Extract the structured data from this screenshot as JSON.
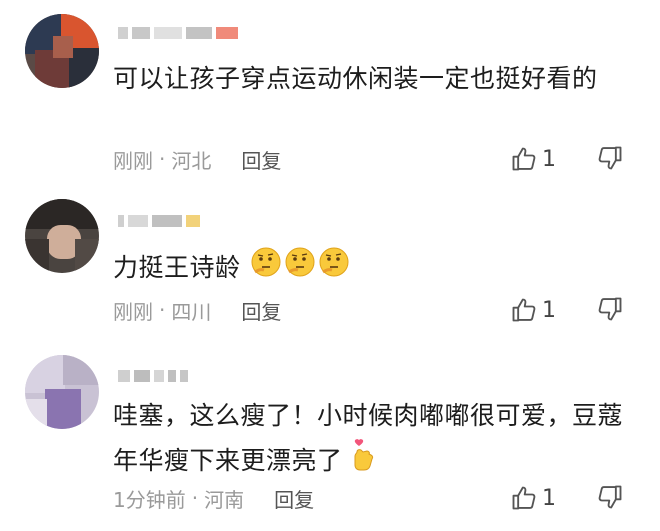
{
  "comments": [
    {
      "text": "可以让孩子穿点运动休闲装一定也挺好看的",
      "time": "刚刚",
      "location": "河北",
      "reply_label": "回复",
      "like_count": "1"
    },
    {
      "text": "力挺王诗龄",
      "time": "刚刚",
      "location": "四川",
      "reply_label": "回复",
      "like_count": "1",
      "emoji": [
        "thinking-face-icon",
        "thinking-face-icon",
        "thinking-face-icon"
      ]
    },
    {
      "text": "哇塞，这么瘦了！小时候肉嘟嘟很可爱，豆蔻年华瘦下来更漂亮了",
      "time": "1分钟前",
      "location": "河南",
      "reply_label": "回复",
      "like_count": "1",
      "emoji": [
        "finger-heart-icon"
      ]
    }
  ],
  "separator": "·",
  "colors": {
    "text": "#1d1d1d",
    "meta": "#9a9a9a",
    "icon": "#555555"
  }
}
